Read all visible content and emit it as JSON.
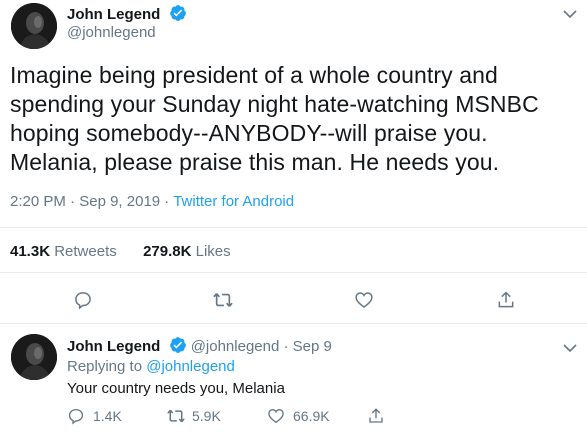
{
  "main_tweet": {
    "author_name": "John Legend",
    "author_handle": "@johnlegend",
    "text_lines": [
      "Imagine being president of a whole country and",
      "spending your Sunday night hate-watching MSNBC",
      "hoping somebody--ANYBODY--will praise you.",
      "Melania, please praise this man.  He needs you."
    ],
    "time": "2:20 PM",
    "date": "Sep 9, 2019",
    "separator": "·",
    "source": "Twitter for Android",
    "retweets_count": "41.3K",
    "retweets_label": "Retweets",
    "likes_count": "279.8K",
    "likes_label": "Likes"
  },
  "reply_tweet": {
    "author_name": "John Legend",
    "author_handle": "@johnlegend",
    "separator": "·",
    "date": "Sep 9",
    "replying_prefix": "Replying to",
    "replying_to": "@johnlegend",
    "text": "Your country needs you, Melania",
    "reply_count": "1.4K",
    "retweet_count": "5.9K",
    "like_count": "66.9K"
  },
  "colors": {
    "accent": "#1da1f2",
    "muted": "#657786",
    "text": "#14171a",
    "divider": "#e6ecf0"
  },
  "icons": [
    "verified-badge-icon",
    "chevron-down-icon",
    "reply-icon",
    "retweet-icon",
    "like-icon",
    "share-icon"
  ]
}
